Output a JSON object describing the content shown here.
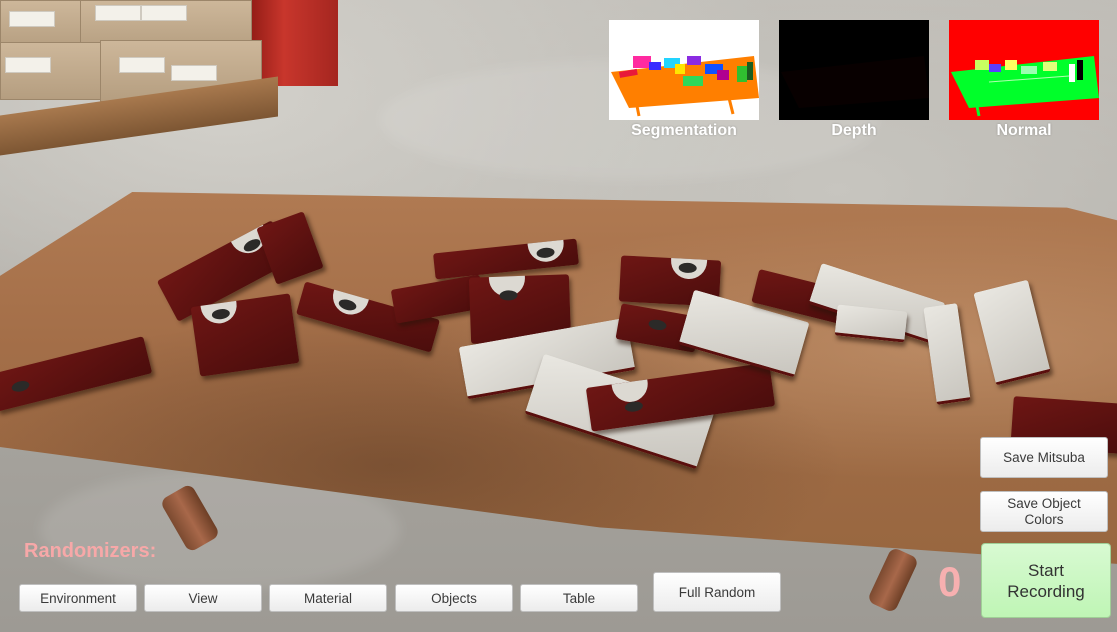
{
  "viewport": {
    "segmentation_label": "Segmentation",
    "depth_label": "Depth",
    "normal_label": "Normal"
  },
  "randomizers": {
    "title": "Randomizers:",
    "buttons": [
      "Environment",
      "View",
      "Material",
      "Objects",
      "Table"
    ],
    "full_random_label": "Full Random"
  },
  "actions": {
    "save_mitsuba_label": "Save Mitsuba",
    "save_object_colors_label": "Save Object Colors",
    "start_recording_label": "Start Recording",
    "frame_count": "0"
  },
  "colors": {
    "randomizers_title": "#f7a8a8",
    "record_button_bg": "#c6f7bd",
    "segmentation_bg": "#ff7f00",
    "normal_bg": "#ff0000",
    "normal_table": "#00ff2a"
  }
}
